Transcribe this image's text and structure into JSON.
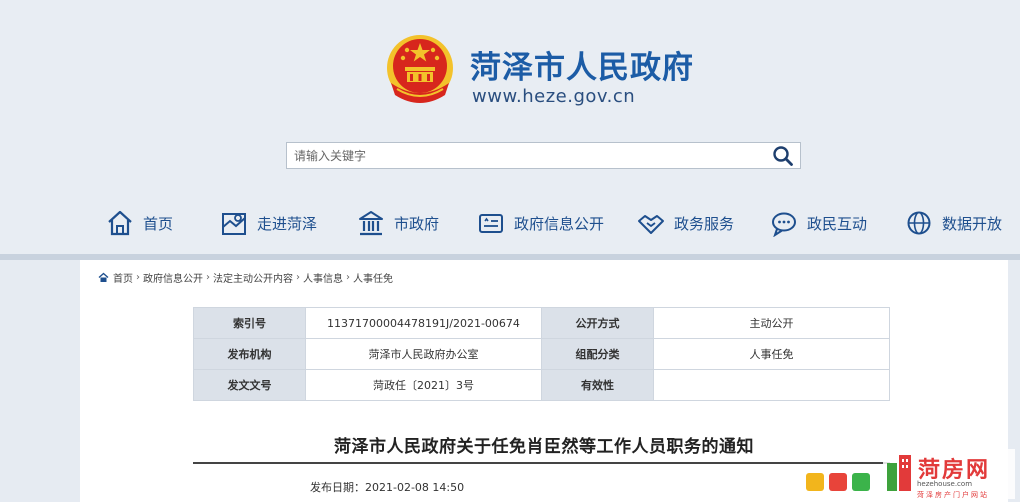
{
  "site": {
    "title": "菏泽市人民政府",
    "url": "www.heze.gov.cn"
  },
  "search": {
    "placeholder": "请输入关键字"
  },
  "nav": [
    {
      "label": "首页",
      "icon": "home-icon"
    },
    {
      "label": "走进菏泽",
      "icon": "map-icon"
    },
    {
      "label": "市政府",
      "icon": "building-icon"
    },
    {
      "label": "政府信息公开",
      "icon": "info-card-icon"
    },
    {
      "label": "政务服务",
      "icon": "handshake-icon"
    },
    {
      "label": "政民互动",
      "icon": "chat-icon"
    },
    {
      "label": "数据开放",
      "icon": "globe-icon"
    }
  ],
  "breadcrumb": [
    "首页",
    "政府信息公开",
    "法定主动公开内容",
    "人事信息",
    "人事任免"
  ],
  "meta": {
    "rows": [
      {
        "l1": "索引号",
        "v1": "11371700004478191J/2021-00674",
        "l2": "公开方式",
        "v2": "主动公开"
      },
      {
        "l1": "发布机构",
        "v1": "菏泽市人民政府办公室",
        "l2": "组配分类",
        "v2": "人事任免"
      },
      {
        "l1": "发文文号",
        "v1": "菏政任〔2021〕3号",
        "l2": "有效性",
        "v2": ""
      }
    ]
  },
  "document": {
    "title": "菏泽市人民政府关于任免肖臣然等工作人员职务的通知",
    "publish_date": "发布日期：2021-02-08 14:50"
  },
  "watermark": {
    "name": "菏房网",
    "domain": "hezehouse.com",
    "slogan": "菏泽房产门户网站"
  },
  "colors": {
    "brand_blue": "#1c5ca6",
    "nav_blue": "#1e4f8e",
    "emblem_red": "#d7261d",
    "emblem_gold": "#f3c22b",
    "watermark_red": "#e23a3a"
  }
}
